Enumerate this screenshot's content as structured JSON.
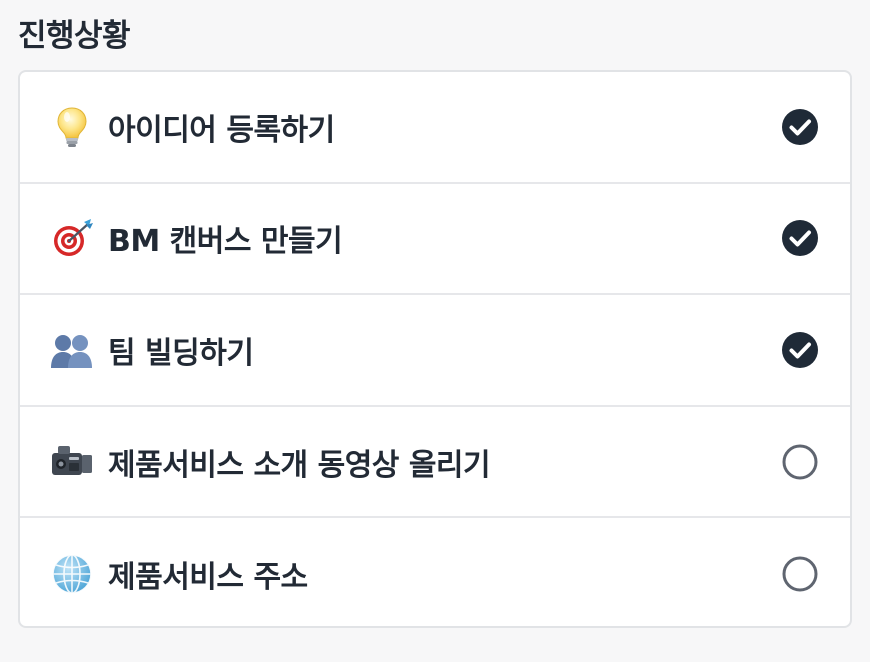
{
  "section": {
    "title": "진행상황"
  },
  "colors": {
    "check_fill": "#1f2a37",
    "uncheck_stroke": "#5f6570",
    "text": "#222a35",
    "border": "#e1e3e6"
  },
  "items": [
    {
      "label": "아이디어 등록하기",
      "icon": "lightbulb-icon",
      "checked": true
    },
    {
      "label": "BM 캔버스 만들기",
      "icon": "target-icon",
      "checked": true
    },
    {
      "label": "팀 빌딩하기",
      "icon": "people-icon",
      "checked": true
    },
    {
      "label": "제품서비스 소개 동영상 올리기",
      "icon": "video-camera-icon",
      "checked": false
    },
    {
      "label": "제품서비스 주소",
      "icon": "globe-icon",
      "checked": false
    }
  ]
}
